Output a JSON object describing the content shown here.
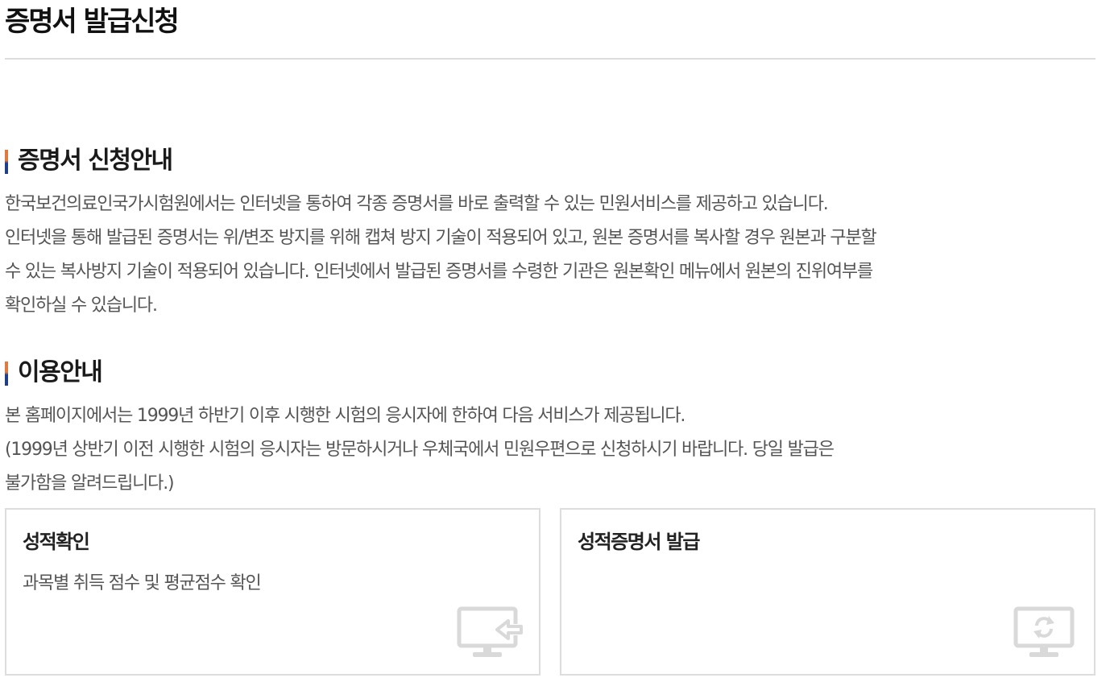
{
  "page": {
    "title": "증명서 발급신청"
  },
  "intro": {
    "heading": "증명서 신청안내",
    "lines": [
      "한국보건의료인국가시험원에서는 인터넷을 통하여 각종 증명서를 바로 출력할 수 있는 민원서비스를 제공하고 있습니다.",
      "인터넷을 통해 발급된 증명서는 위/변조 방지를 위해 캡쳐 방지 기술이 적용되어 있고, 원본 증명서를 복사할 경우 원본과 구분할",
      "수 있는 복사방지 기술이 적용되어 있습니다. 인터넷에서 발급된 증명서를 수령한 기관은 원본확인 메뉴에서 원본의 진위여부를",
      "확인하실 수 있습니다."
    ]
  },
  "usage": {
    "heading": "이용안내",
    "lines": [
      "본 홈페이지에서는 1999년 하반기 이후 시행한 시험의 응시자에 한하여 다음 서비스가 제공됩니다.",
      "(1999년 상반기 이전 시행한 시험의 응시자는 방문하시거나 우체국에서 민원우편으로 신청하시기 바랍니다. 당일 발급은",
      "불가함을 알려드립니다.)"
    ]
  },
  "cards": [
    {
      "title": "성적확인",
      "description": "과목별 취득 점수 및 평균점수 확인",
      "icon": "monitor-arrow-icon"
    },
    {
      "title": "성적증명서 발급",
      "description": "",
      "icon": "monitor-refresh-icon"
    }
  ],
  "colors": {
    "accent_orange": "#e07a3e",
    "accent_navy": "#1f3f8a",
    "icon_gray": "#d9d9d9",
    "border_gray": "#dddddd"
  }
}
